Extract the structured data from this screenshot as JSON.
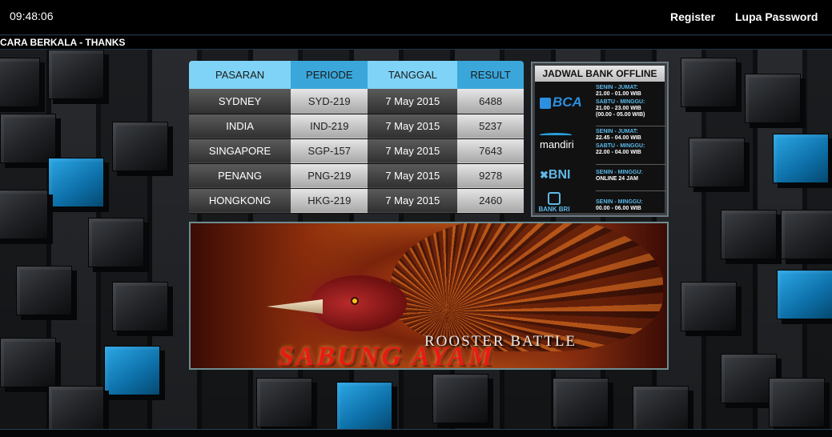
{
  "header": {
    "clock": "09:48:06",
    "register_label": "Register",
    "lupa_password_label": "Lupa Password"
  },
  "marquee": {
    "text": "CARA BERKALA - THANKS"
  },
  "results": {
    "columns": [
      "PASARAN",
      "PERIODE",
      "TANGGAL",
      "RESULT"
    ],
    "rows": [
      {
        "pasaran": "SYDNEY",
        "periode": "SYD-219",
        "tanggal": "7 May 2015",
        "result": "6488"
      },
      {
        "pasaran": "INDIA",
        "periode": "IND-219",
        "tanggal": "7 May 2015",
        "result": "5237"
      },
      {
        "pasaran": "SINGAPORE",
        "periode": "SGP-157",
        "tanggal": "7 May 2015",
        "result": "7643"
      },
      {
        "pasaran": "PENANG",
        "periode": "PNG-219",
        "tanggal": "7 May 2015",
        "result": "9278"
      },
      {
        "pasaran": "HONGKONG",
        "periode": "HKG-219",
        "tanggal": "7 May 2015",
        "result": "2460"
      }
    ]
  },
  "bank": {
    "title": "JADWAL BANK OFFLINE",
    "banks": [
      {
        "name": "BCA",
        "schedule": [
          {
            "day": "SENIN - JUMAT:",
            "time": "21.00 - 01.00 WIB"
          },
          {
            "day": "SABTU - MINGGU:",
            "time": "21.00 - 23.00 WIB"
          },
          {
            "day": "",
            "time": "(00.00 - 05.00 WIB)"
          }
        ]
      },
      {
        "name": "mandiri",
        "schedule": [
          {
            "day": "SENIN - JUMAT:",
            "time": "22.45 - 04.00 WIB"
          },
          {
            "day": "SABTU - MINGGU:",
            "time": "22.00 - 04.00 WIB"
          }
        ]
      },
      {
        "name": "BNI",
        "schedule": [
          {
            "day": "SENIN - MINGGU:",
            "time": "ONLINE 24 JAM"
          }
        ]
      },
      {
        "name": "BANK BRI",
        "schedule": [
          {
            "day": "SENIN - MINGGU:",
            "time": "00.00 - 06.00 WIB"
          }
        ]
      }
    ]
  },
  "banner": {
    "subtitle": "ROOSTER BATTLE",
    "title": "SABUNG AYAM"
  },
  "colors": {
    "header_light_blue": "#7fd3f6",
    "header_blue": "#3aa6da",
    "bank_day_blue": "#5ab9ea",
    "banner_red": "#e81b12"
  }
}
